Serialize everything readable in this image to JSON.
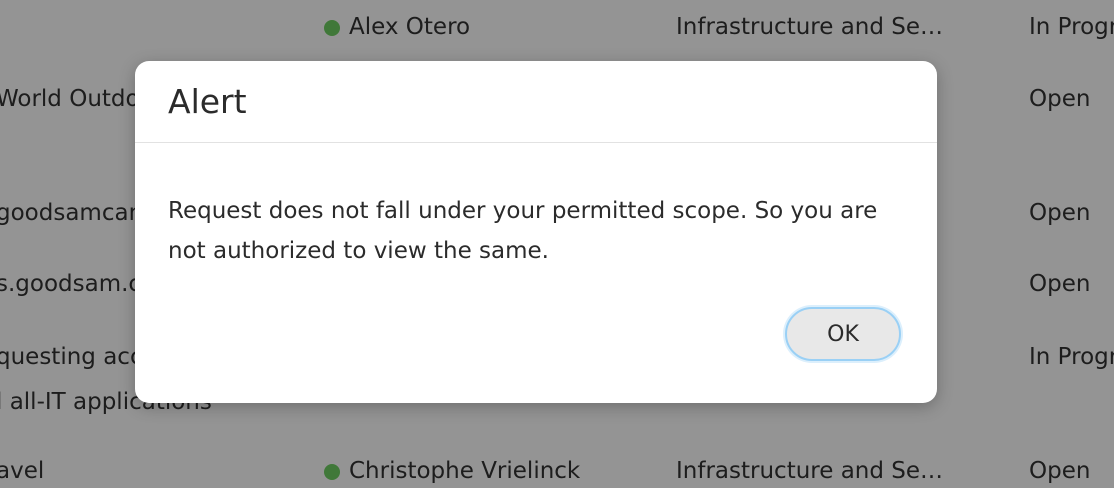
{
  "table": {
    "rows": [
      {
        "title": "",
        "title_line2": "",
        "assignee": "Alex Otero",
        "group": "Infrastructure and Sec...",
        "status": "In Progr"
      },
      {
        "title": "World Outdo",
        "title_line2": "",
        "assignee": "",
        "group": "",
        "status": "Open"
      },
      {
        "title": "goodsamcan",
        "title_line2": "",
        "assignee": "",
        "group": "",
        "status": "Open"
      },
      {
        "title": "s.goodsam.c",
        "title_line2": "",
        "assignee": "",
        "group": "",
        "status": "Open"
      },
      {
        "title": "questing acc",
        "title_line2": "l all-IT applications",
        "assignee": "",
        "group": "",
        "status": "In Progr"
      },
      {
        "title": "avel",
        "title_line2": "",
        "assignee": "Christophe Vrielinck",
        "group": "Infrastructure and Sec...",
        "status": "Open"
      }
    ],
    "assignee_dot_color": "#6fcf62"
  },
  "dialog": {
    "title": "Alert",
    "message": "Request does not fall under your permitted scope. So you are not authorized to view the same.",
    "ok_label": "OK"
  }
}
